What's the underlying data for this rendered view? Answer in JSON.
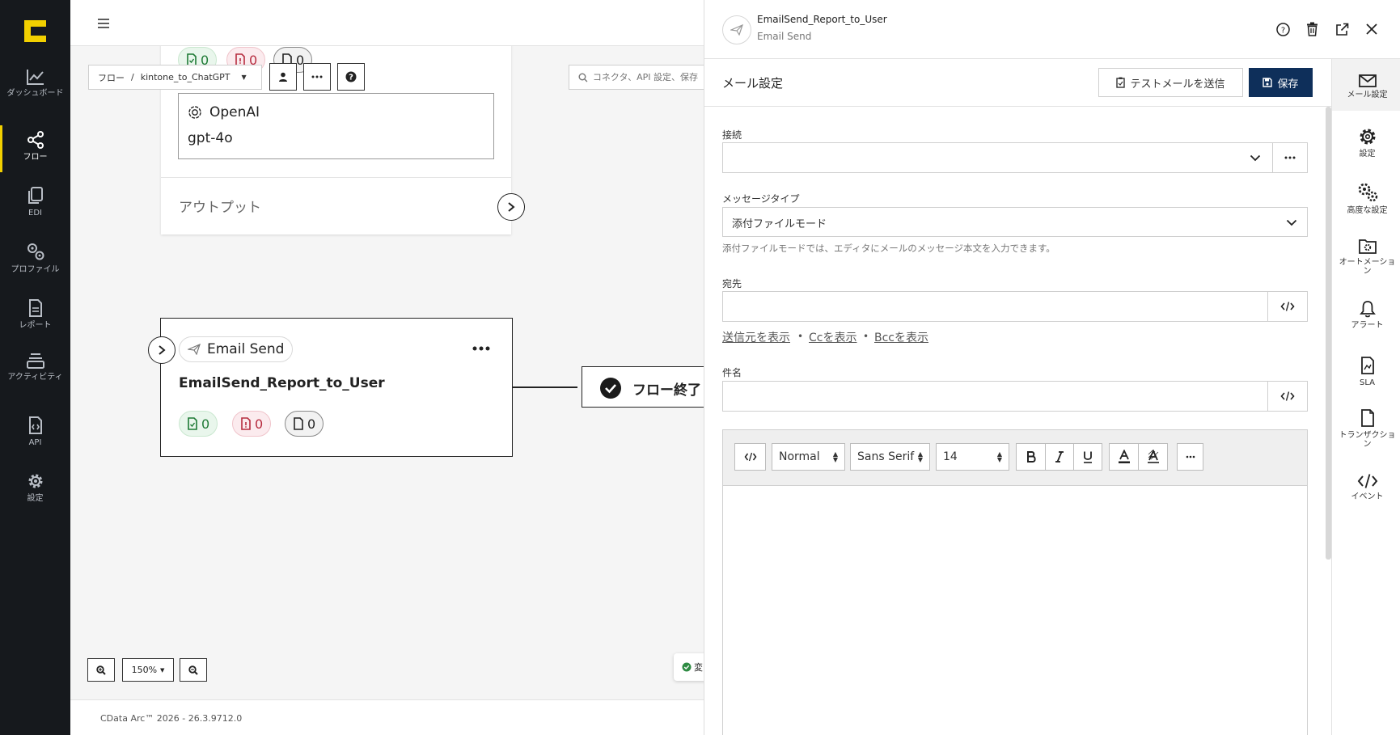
{
  "sidebar": {
    "items": [
      {
        "label": "ダッシュボード",
        "icon": "chart-line-icon"
      },
      {
        "label": "フロー",
        "icon": "flow-share-icon"
      },
      {
        "label": "EDI",
        "icon": "documents-icon"
      },
      {
        "label": "プロファイル",
        "icon": "gears-icon"
      },
      {
        "label": "レポート",
        "icon": "report-file-icon"
      },
      {
        "label": "アクティビティ",
        "icon": "activity-stack-icon"
      },
      {
        "label": "API",
        "icon": "api-file-icon"
      },
      {
        "label": "設定",
        "icon": "gear-icon"
      }
    ]
  },
  "canvas": {
    "breadcrumb": {
      "root": "フロー",
      "sep": "/",
      "flow": "kintone_to_ChatGPT"
    },
    "search_placeholder": "コネクタ、API 設定、保存",
    "openai_node": {
      "counts": [
        "0",
        "0",
        "0"
      ],
      "provider": "OpenAI",
      "model": "gpt-4o",
      "output_label": "アウトプット"
    },
    "email_node": {
      "type_label": "Email Send",
      "name": "EmailSend_Report_to_User",
      "counts": [
        "0",
        "0",
        "0"
      ]
    },
    "end_node": {
      "label": "フロー終了"
    },
    "zoom": "150%",
    "status_text": "変",
    "footer": "CData Arc™ 2026 - 26.3.9712.0"
  },
  "panel": {
    "header": {
      "title": "EmailSend_Report_to_User",
      "subtitle": "Email Send"
    },
    "section_title": "メール設定",
    "test_button": "テストメールを送信",
    "save_button": "保存",
    "connection_label": "接続",
    "connection_value": "",
    "message_type_label": "メッセージタイプ",
    "message_type_value": "添付ファイルモード",
    "message_type_help": "添付ファイルモードでは、エディタにメールのメッセージ本文を入力できます。",
    "to_label": "宛先",
    "to_value": "",
    "show_links": [
      "送信元を表示",
      "Ccを表示",
      "Bccを表示"
    ],
    "link_sep": "•",
    "subject_label": "件名",
    "subject_value": "",
    "editor": {
      "format": "Normal",
      "font": "Sans Serif",
      "size": "14"
    },
    "right_nav": [
      {
        "label": "メール設定",
        "icon": "mail-icon"
      },
      {
        "label": "設定",
        "icon": "gear-icon"
      },
      {
        "label": "高度な設定",
        "icon": "advanced-gears-icon"
      },
      {
        "label": "オートメーション",
        "icon": "automation-folder-icon"
      },
      {
        "label": "アラート",
        "icon": "bell-icon"
      },
      {
        "label": "SLA",
        "icon": "sla-file-icon"
      },
      {
        "label": "トランザクション",
        "icon": "transaction-file-icon"
      },
      {
        "label": "イベント",
        "icon": "code-icon"
      }
    ]
  }
}
